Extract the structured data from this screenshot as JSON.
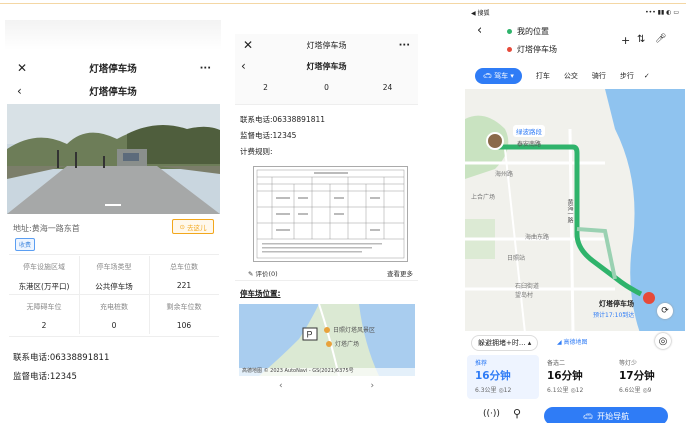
{
  "panel1": {
    "title": "灯塔停车场",
    "address": "地址:黄海一路东首",
    "navigate_label": "去这儿",
    "charge_tag": "收费",
    "stats": [
      {
        "label": "停车设施区域",
        "value": "东港区(万平口)"
      },
      {
        "label": "停车场类型",
        "value": "公共停车场"
      },
      {
        "label": "总车位数",
        "value": "221"
      },
      {
        "label": "无障碍车位",
        "value": "2"
      },
      {
        "label": "充电桩数",
        "value": "0"
      },
      {
        "label": "剩余车位数",
        "value": "106"
      }
    ],
    "contact_phone": "联系电话:06338891811",
    "supervise_phone": "监督电话:12345"
  },
  "panel2": {
    "window_title": "灯塔停车场",
    "page_title": "灯塔停车场",
    "stats_values": [
      "2",
      "0",
      "24"
    ],
    "contact_phone": "联系电话:06338891811",
    "supervise_phone": "监督电话:12345",
    "billing_label": "计费规则:",
    "review_label": "评价(0)",
    "more_label": "查看更多",
    "location_label": "停车场位置:",
    "map_poi": "日照灯塔风景区",
    "map_poi2": "灯塔广场",
    "map_copyright": "高德地图 © 2023 AutoNavi - GS(2021)6375号"
  },
  "panel3": {
    "status_left": "◀ 搜狐",
    "my_location": "我的位置",
    "destination": "灯塔停车场",
    "mode_tabs": [
      "驾车",
      "打车",
      "公交",
      "骑行",
      "步行"
    ],
    "map_labels": {
      "green_road": "绿波路段",
      "road1": "泰安南路",
      "road2": "海州路",
      "road3": "海曲东路",
      "road4": "上合广场",
      "road5": "日照站",
      "road6": "石臼街道",
      "road7": "望岛村",
      "road8": "黄海一路",
      "dest": "灯塔停车场",
      "eta": "预计17:10到达"
    },
    "prefer_label": "躲避拥堵+时...",
    "amap_logo": "高德地图",
    "routes": [
      {
        "tag": "推荐",
        "time": "16分钟",
        "info": "6.3公里 ◎12"
      },
      {
        "tag": "备选二",
        "time": "16分钟",
        "info": "6.1公里 ◎12"
      },
      {
        "tag": "等灯少",
        "time": "17分钟",
        "info": "6.6公里 ◎9"
      }
    ],
    "start_label": "开始导航",
    "colors": {
      "route": "#2fb36b",
      "accent": "#2f7cf6",
      "destination": "#e64a3a"
    }
  }
}
